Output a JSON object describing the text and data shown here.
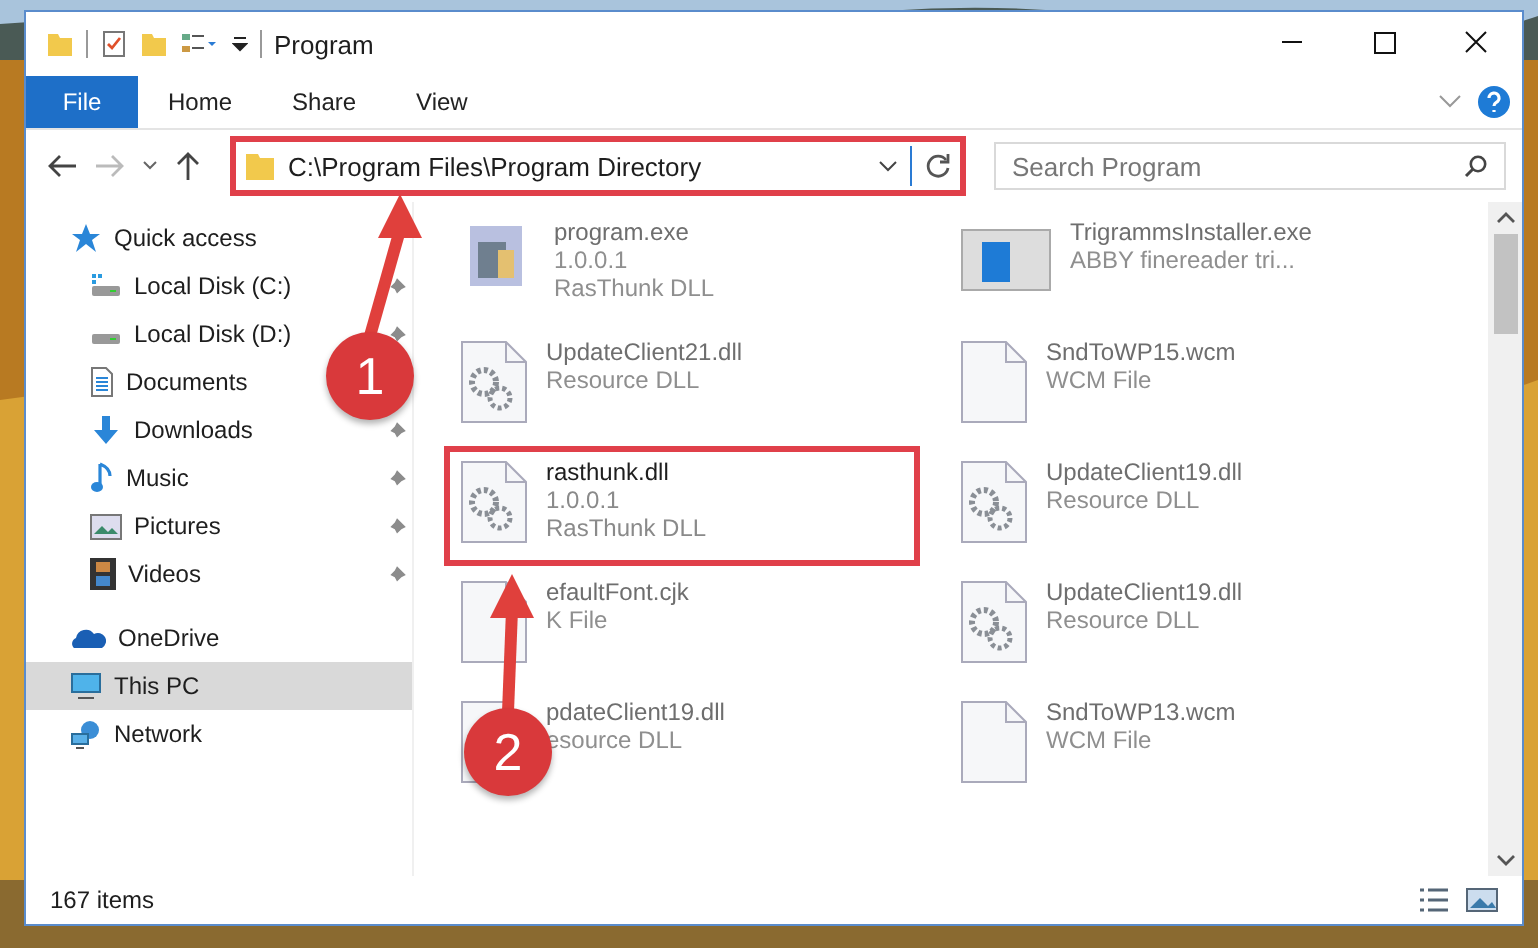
{
  "window": {
    "title": "Program"
  },
  "ribbon": {
    "tabs": [
      {
        "label": "File",
        "kind": "file"
      },
      {
        "label": "Home",
        "kind": "tab"
      },
      {
        "label": "Share",
        "kind": "tab"
      },
      {
        "label": "View",
        "kind": "tab"
      }
    ]
  },
  "address_bar": {
    "path": "C:\\Program Files\\Program Directory",
    "highlighted": true
  },
  "search": {
    "placeholder": "Search Program"
  },
  "sidebar": {
    "items": [
      {
        "label": "Quick access",
        "selected": false,
        "children": [
          {
            "label": "Local Disk (C:)",
            "pinned": true
          },
          {
            "label": "Local Disk (D:)",
            "pinned": true
          },
          {
            "label": "Documents",
            "pinned": false
          },
          {
            "label": "Downloads",
            "pinned": true
          },
          {
            "label": "Music",
            "pinned": true
          },
          {
            "label": "Pictures",
            "pinned": true
          },
          {
            "label": "Videos",
            "pinned": true
          }
        ]
      },
      {
        "label": "OneDrive",
        "selected": false
      },
      {
        "label": "This PC",
        "selected": true
      },
      {
        "label": "Network",
        "selected": false
      }
    ]
  },
  "files": [
    {
      "kind": "exe",
      "lines": [
        "program.exe",
        "1.0.0.1",
        "RasThunk DLL"
      ],
      "blurred": true,
      "highlighted": false
    },
    {
      "kind": "installer",
      "lines": [
        "TrigrammsInstaller.exe",
        "ABBY finereader tri..."
      ],
      "blurred": true,
      "highlighted": false
    },
    {
      "kind": "dll",
      "lines": [
        "UpdateClient21.dll",
        "Resource DLL"
      ],
      "blurred": true,
      "highlighted": false
    },
    {
      "kind": "file",
      "lines": [
        "SndToWP15.wcm",
        "WCM File"
      ],
      "blurred": true,
      "highlighted": false
    },
    {
      "kind": "dll",
      "lines": [
        "rasthunk.dll",
        "1.0.0.1",
        "RasThunk DLL"
      ],
      "blurred": false,
      "highlighted": true
    },
    {
      "kind": "dll",
      "lines": [
        "UpdateClient19.dll",
        "Resource DLL"
      ],
      "blurred": true,
      "highlighted": false
    },
    {
      "kind": "file",
      "lines": [
        "efaultFont.cjk",
        "K File"
      ],
      "blurred": true,
      "highlighted": false
    },
    {
      "kind": "dll",
      "lines": [
        "UpdateClient19.dll",
        "Resource DLL"
      ],
      "blurred": true,
      "highlighted": false
    },
    {
      "kind": "dll",
      "lines": [
        "pdateClient19.dll",
        "esource DLL"
      ],
      "blurred": true,
      "highlighted": false
    },
    {
      "kind": "file",
      "lines": [
        "SndToWP13.wcm",
        "WCM File"
      ],
      "blurred": true,
      "highlighted": false
    }
  ],
  "callouts": [
    {
      "number": "1"
    },
    {
      "number": "2"
    }
  ],
  "status_bar": {
    "item_count": "167 items"
  }
}
